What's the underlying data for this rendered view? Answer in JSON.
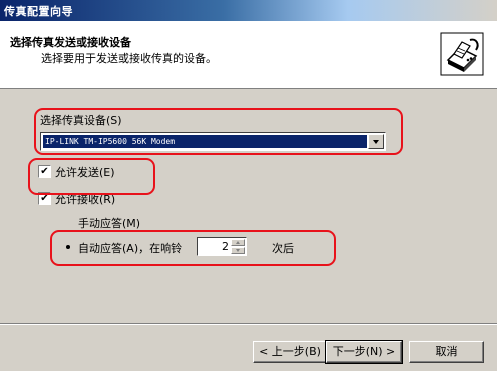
{
  "window": {
    "title": "传真配置向导"
  },
  "header": {
    "title": "选择传真发送或接收设备",
    "subtitle": "选择要用于发送或接收传真的设备。",
    "icon": "fax-wizard-icon"
  },
  "device": {
    "label": "选择传真设备(S)",
    "selected": "IP-LINK TM-IP5600 56K Modem"
  },
  "options": {
    "send_label": "允许发送(E)",
    "send_checked": true,
    "receive_label": "允许接收(R)",
    "receive_checked": true,
    "manual_label": "手动应答(M)",
    "manual_selected": false,
    "auto_label": "自动应答(A)，在响铃",
    "auto_selected": true,
    "rings_value": "2",
    "rings_suffix": "次后"
  },
  "buttons": {
    "back": "< 上一步(B)",
    "next": "下一步(N) >",
    "cancel": "取消"
  },
  "colors": {
    "title_gradient_start": "#0a246a",
    "selection": "#0a246a",
    "annotation": "#e8121b",
    "face": "#d4d0c8"
  }
}
